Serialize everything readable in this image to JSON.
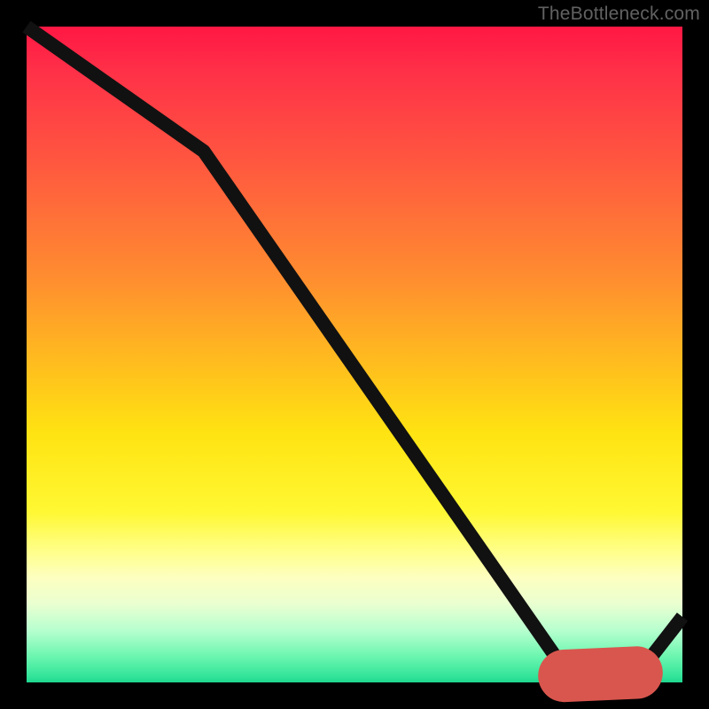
{
  "watermark": "TheBottleneck.com",
  "chart_data": {
    "type": "line",
    "title": "",
    "xlabel": "",
    "ylabel": "",
    "xlim": [
      0,
      100
    ],
    "ylim": [
      0,
      100
    ],
    "grid": false,
    "legend": false,
    "series": [
      {
        "name": "curve",
        "x": [
          0.0,
          27.0,
          82.0,
          93.0,
          100.0
        ],
        "values": [
          100.0,
          81.0,
          2.0,
          1.0,
          10.0
        ]
      }
    ],
    "markers": {
      "name": "highlight-segment",
      "x_start": 82.0,
      "x_end": 93.0,
      "y": 1.5
    },
    "colors": {
      "gradient_top": "#ff1744",
      "gradient_mid": "#ffe312",
      "gradient_bottom": "#1ed78f",
      "line": "#111111",
      "marker": "#d9564e",
      "background": "#000000"
    }
  }
}
